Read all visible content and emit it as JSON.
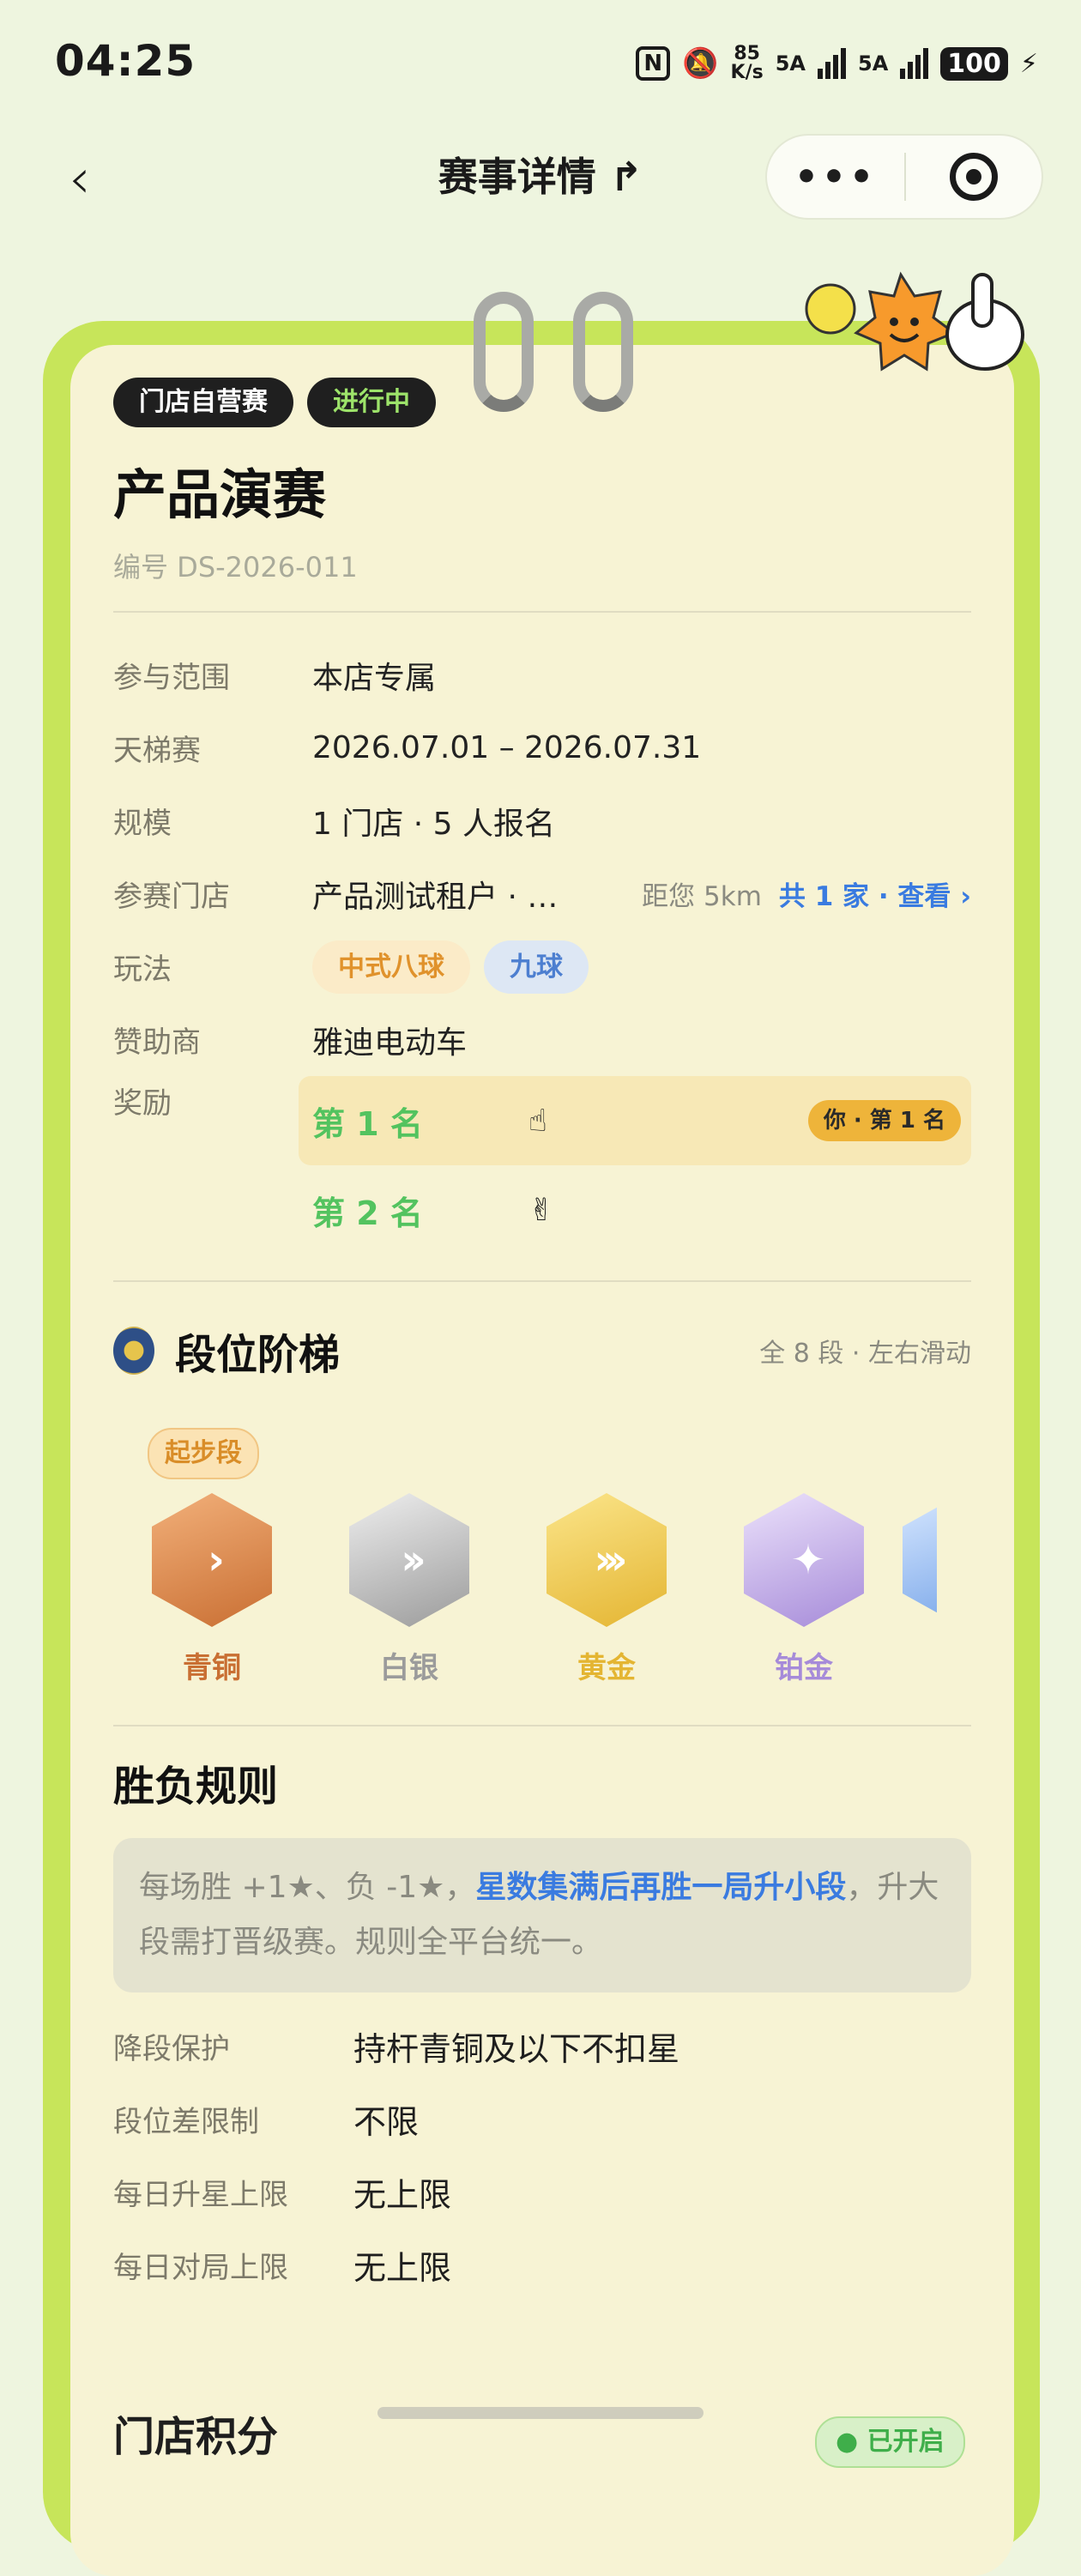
{
  "status_bar": {
    "time": "04:25",
    "speed_top": "85",
    "speed_bottom": "K/s",
    "net1": "5A",
    "net2": "5A",
    "battery": "100"
  },
  "nav": {
    "back_glyph": "‹",
    "title": "赛事详情 ↱",
    "more": "•••"
  },
  "event": {
    "tag_type": "门店自营赛",
    "tag_status": "进行中",
    "title": "产品演赛",
    "serial": "编号 DS-2026-011"
  },
  "details": {
    "scope_label": "参与范围",
    "scope_value": "本店专属",
    "ladder_label": "天梯赛",
    "ladder_value": "2026.07.01 – 2026.07.31",
    "scale_label": "规模",
    "scale_value": "1 门店 · 5 人报名",
    "stores_label": "参赛门店",
    "stores_value": "产品测试租户 · …",
    "stores_distance": "距您 5km",
    "stores_link": "共 1 家 · 查看 ›",
    "play_label": "玩法",
    "play_chips": [
      "中式八球",
      "九球"
    ],
    "sponsor_label": "赞助商",
    "sponsor_value": "雅迪电动车",
    "reward_label": "奖励",
    "rewards": [
      {
        "rank": "第 1 名",
        "emoji": "☝",
        "me": "你 · 第 1 名"
      },
      {
        "rank": "第 2 名",
        "emoji": "✌"
      }
    ]
  },
  "ladder": {
    "title": "段位阶梯",
    "sub": "全 8 段 · 左右滑动",
    "start_tag": "起步段",
    "tiers": [
      {
        "name": "青铜",
        "symbol": "›",
        "color": "#c96f33"
      },
      {
        "name": "白银",
        "symbol": "››",
        "color": "#9b9b9b"
      },
      {
        "name": "黄金",
        "symbol": "›››",
        "color": "#e4b532"
      },
      {
        "name": "铂金",
        "symbol": "✦",
        "color": "#a68bd9"
      }
    ]
  },
  "rules": {
    "title": "胜负规则",
    "box_pre": "每场胜 +1★、负 -1★，",
    "box_highlight": "星数集满后再胜一局升小段",
    "box_post": "，升大段需打晋级赛。规则全平台统一。",
    "rows": [
      {
        "label": "降段保护",
        "value": "持杆青铜及以下不扣星"
      },
      {
        "label": "段位差限制",
        "value": "不限"
      },
      {
        "label": "每日升星上限",
        "value": "无上限"
      },
      {
        "label": "每日对局上限",
        "value": "无上限"
      }
    ]
  },
  "next_section": {
    "title": "门店积分",
    "status": "● 已开启"
  }
}
